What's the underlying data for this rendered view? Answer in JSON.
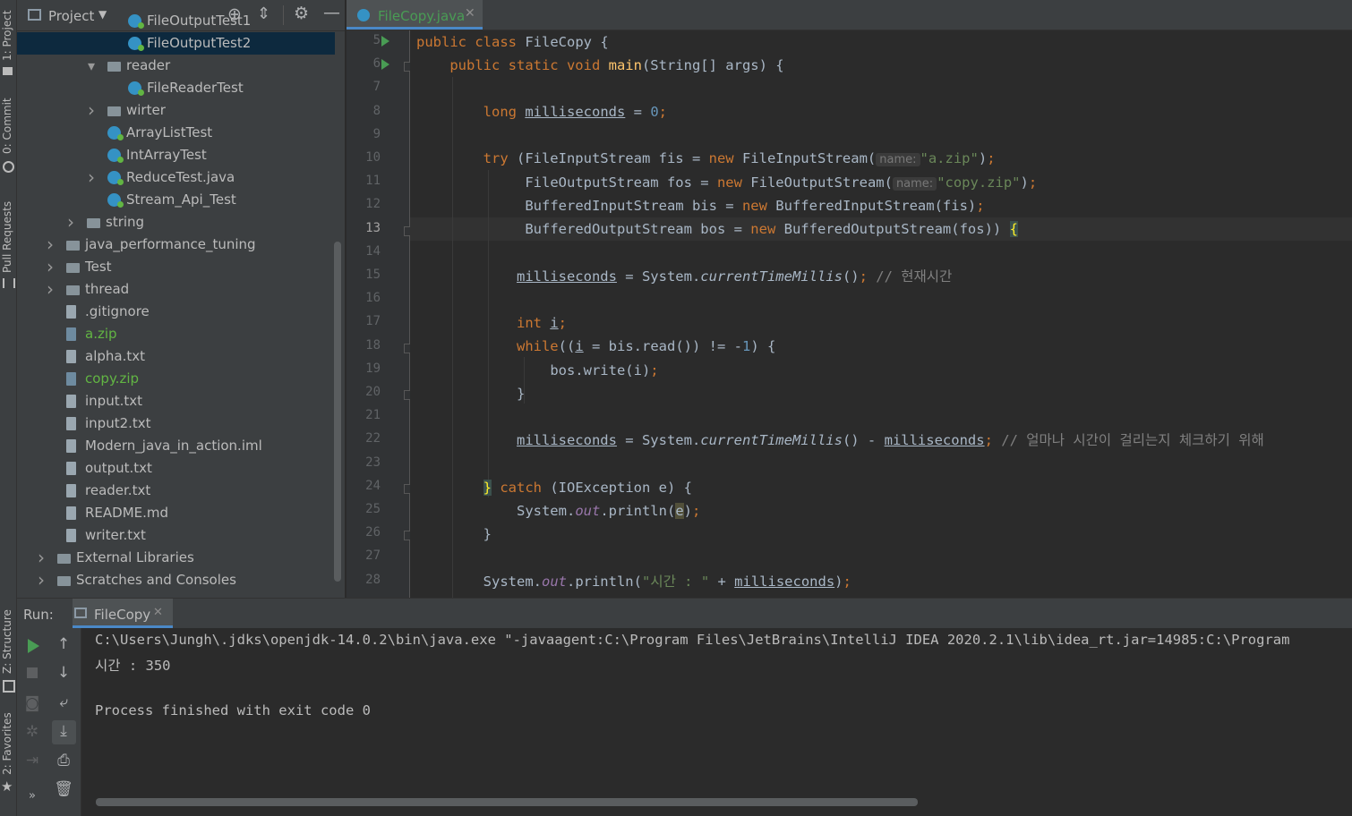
{
  "left_strip": {
    "tabs": [
      "1: Project",
      "0: Commit",
      "Pull Requests",
      "Z: Structure",
      "2: Favorites"
    ]
  },
  "project_panel": {
    "title": "Project",
    "tree": [
      {
        "label": "FileOutputTest1",
        "type": "class",
        "depth": 3,
        "expanded": null
      },
      {
        "label": "FileOutputTest2",
        "type": "class",
        "depth": 3,
        "expanded": null,
        "selected": true
      },
      {
        "label": "reader",
        "type": "folder",
        "depth": 2,
        "expanded": true
      },
      {
        "label": "FileReaderTest",
        "type": "class",
        "depth": 3,
        "expanded": null
      },
      {
        "label": "wirter",
        "type": "folder",
        "depth": 2,
        "expanded": false
      },
      {
        "label": "ArrayListTest",
        "type": "class",
        "depth": 2,
        "expanded": null
      },
      {
        "label": "IntArrayTest",
        "type": "class",
        "depth": 2,
        "expanded": null
      },
      {
        "label": "ReduceTest.java",
        "type": "class",
        "depth": 2,
        "expanded": false
      },
      {
        "label": "Stream_Api_Test",
        "type": "class",
        "depth": 2,
        "expanded": null
      },
      {
        "label": "string",
        "type": "folder",
        "depth": 1,
        "expanded": false
      },
      {
        "label": "java_performance_tuning",
        "type": "folder",
        "depth": 0,
        "expanded": false
      },
      {
        "label": "Test",
        "type": "folder",
        "depth": 0,
        "expanded": false
      },
      {
        "label": "thread",
        "type": "folder",
        "depth": 0,
        "expanded": false
      },
      {
        "label": ".gitignore",
        "type": "file",
        "depth": 0,
        "expanded": null
      },
      {
        "label": "a.zip",
        "type": "zip",
        "depth": 0,
        "expanded": null,
        "green": true
      },
      {
        "label": "alpha.txt",
        "type": "file",
        "depth": 0,
        "expanded": null
      },
      {
        "label": "copy.zip",
        "type": "zip",
        "depth": 0,
        "expanded": null,
        "green": true
      },
      {
        "label": "input.txt",
        "type": "file",
        "depth": 0,
        "expanded": null
      },
      {
        "label": "input2.txt",
        "type": "file",
        "depth": 0,
        "expanded": null
      },
      {
        "label": "Modern_java_in_action.iml",
        "type": "file",
        "depth": 0,
        "expanded": null
      },
      {
        "label": "output.txt",
        "type": "file",
        "depth": 0,
        "expanded": null
      },
      {
        "label": "reader.txt",
        "type": "file",
        "depth": 0,
        "expanded": null
      },
      {
        "label": "README.md",
        "type": "file",
        "depth": 0,
        "expanded": null
      },
      {
        "label": "writer.txt",
        "type": "file",
        "depth": 0,
        "expanded": null
      },
      {
        "label": "External Libraries",
        "type": "lib",
        "depth": -1,
        "expanded": false
      },
      {
        "label": "Scratches and Consoles",
        "type": "lib",
        "depth": -1,
        "expanded": false
      }
    ]
  },
  "editor": {
    "tab_label": "FileCopy.java",
    "current_line": 13,
    "line_numbers": [
      5,
      6,
      7,
      8,
      9,
      10,
      11,
      12,
      13,
      14,
      15,
      16,
      17,
      18,
      19,
      20,
      21,
      22,
      23,
      24,
      25,
      26,
      27,
      28
    ],
    "code": {
      "l5": {
        "t1": "public class ",
        "t2": "FileCopy {"
      },
      "l6": {
        "t1": "public static void ",
        "t2": "main",
        "t3": "(String[] args) {"
      },
      "l8": {
        "t1": "long ",
        "t2": "milliseconds",
        "t3": " = ",
        "t4": "0",
        "t5": ";"
      },
      "l10": {
        "t1": "try ",
        "t2": "(FileInputStream fis = ",
        "t3": "new ",
        "t4": "FileInputStream(",
        "hint": "name:",
        "str": "\"a.zip\"",
        "t5": ")",
        "t6": ";"
      },
      "l11": {
        "t1": "FileOutputStream fos = ",
        "t2": "new ",
        "t3": "FileOutputStream(",
        "hint": "name:",
        "str": "\"copy.zip\"",
        "t4": ")",
        "t5": ";"
      },
      "l12": {
        "t1": "BufferedInputStream bis = ",
        "t2": "new ",
        "t3": "BufferedInputStream(fis)",
        "t4": ";"
      },
      "l13": {
        "t1": "BufferedOutputStream bos = ",
        "t2": "new ",
        "t3": "BufferedOutputStream(fos)) ",
        "t4": "{"
      },
      "l15": {
        "t1": "milliseconds",
        "t2": " = System.",
        "t3": "currentTimeMillis",
        "t4": "()",
        "t5": "; ",
        "cmt": "// 현재시간"
      },
      "l17": {
        "t1": "int ",
        "t2": "i",
        "t3": ";"
      },
      "l18": {
        "t1": "while",
        "t2": "((",
        "t3": "i",
        "t4": " = bis.read()) != -",
        "t5": "1",
        "t6": ") {"
      },
      "l19": {
        "t1": "bos.write(i)",
        "t2": ";"
      },
      "l20": {
        "t1": "}"
      },
      "l22": {
        "t1": "milliseconds",
        "t2": " = System.",
        "t3": "currentTimeMillis",
        "t4": "() - ",
        "t5": "milliseconds",
        "t6": "; ",
        "cmt": "// 얼마나 시간이 걸리는지 체크하기 위해"
      },
      "l24": {
        "t1": "}",
        "t2": " catch ",
        "t3": "(IOException e) {"
      },
      "l25": {
        "t1": "System.",
        "t2": "out",
        "t3": ".println(",
        "t4": "e",
        "t5": ")",
        "t6": ";"
      },
      "l26": {
        "t1": "}"
      },
      "l28": {
        "t1": "System.",
        "t2": "out",
        "t3": ".println(",
        "str": "\"시간 : \"",
        "t4": " + ",
        "t5": "milliseconds",
        "t6": ")",
        "t7": ";"
      }
    }
  },
  "run_panel": {
    "label": "Run:",
    "tab_label": "FileCopy",
    "console": [
      "C:\\Users\\Jungh\\.jdks\\openjdk-14.0.2\\bin\\java.exe \"-javaagent:C:\\Program Files\\JetBrains\\IntelliJ IDEA 2020.2.1\\lib\\idea_rt.jar=14985:C:\\Program",
      "시간 : 350",
      "",
      "Process finished with exit code 0"
    ]
  },
  "colors": {
    "background": "#2b2b2b",
    "panel": "#3c3f41",
    "keyword": "#cc7832",
    "string": "#6a8759",
    "number": "#6897bb",
    "accent": "#4a88c7",
    "run_green": "#499c54"
  }
}
